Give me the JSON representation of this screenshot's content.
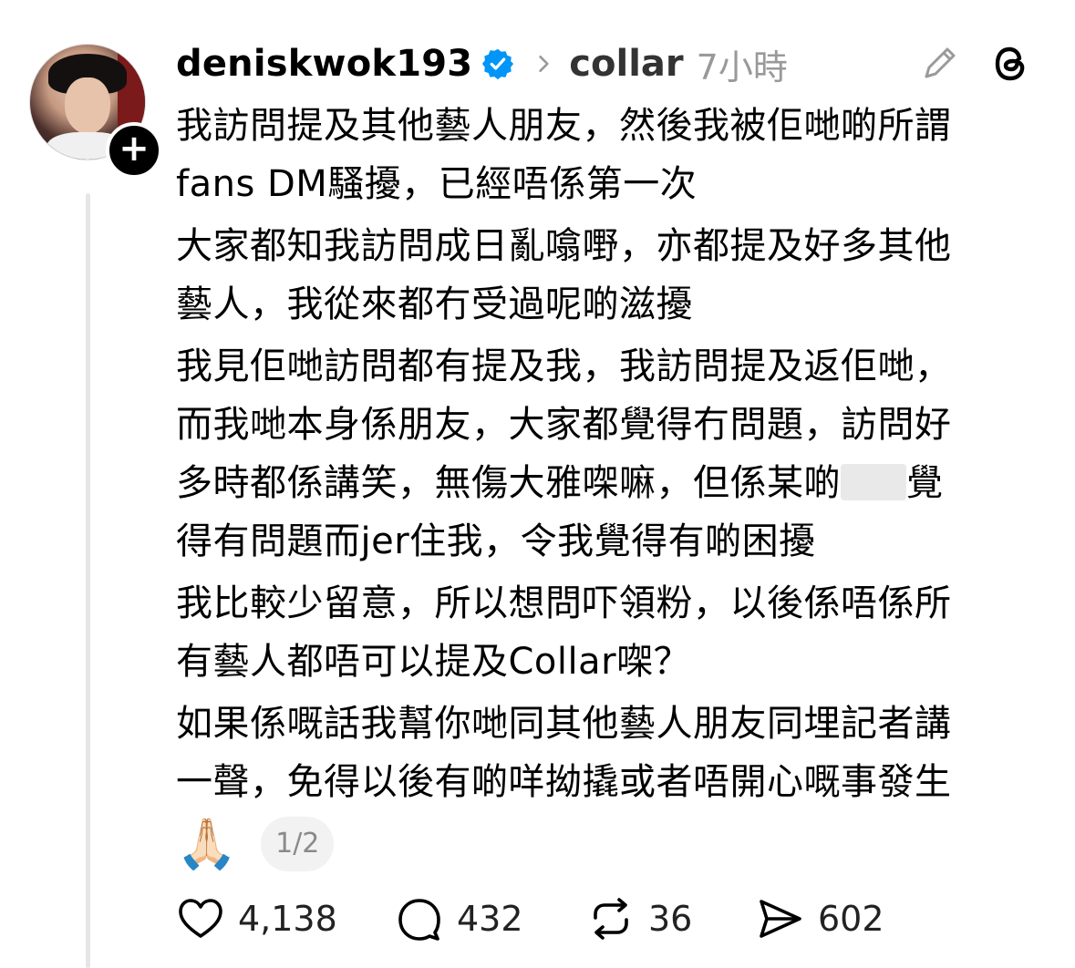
{
  "post": {
    "username": "deniskwok193",
    "topic": "collar",
    "time_ago": "7小時",
    "follow_symbol": "+",
    "paragraphs": [
      {
        "lines": [
          "我訪問提及其他藝人朋友，然後我被佢哋啲所謂",
          "fans DM騷擾，已經唔係第一次"
        ]
      },
      {
        "lines": [
          "大家都知我訪問成日亂噏嘢，亦都提及好多其他",
          "藝人，我從來都冇受過呢啲滋擾"
        ]
      },
      {
        "lines": [
          "我見佢哋訪問都有提及我，我訪問提及返佢哋，",
          "而我哋本身係朋友，大家都覺得冇問題，訪問好"
        ],
        "line3_before_blur": "多時都係講笑，無傷大雅㗎嘛，但係某啲",
        "line3_after_blur": "覺",
        "line4": "得有問題而jer住我，令我覺得有啲困擾"
      },
      {
        "lines": [
          "我比較少留意，所以想問吓領粉，以後係唔係所",
          "有藝人都唔可以提及Collar㗎？"
        ]
      },
      {
        "lines": [
          "如果係嘅話我幫你哋同其他藝人朋友同埋記者講",
          "一聲，免得以後有啲咩拗撬或者唔開心嘅事發生"
        ]
      }
    ],
    "emoji": "🙏🏻",
    "page_indicator": "1/2",
    "stats": {
      "likes": "4,138",
      "comments": "432",
      "reposts": "36",
      "shares": "602"
    }
  },
  "colors": {
    "verified_blue": "#0095f6",
    "muted_text": "#999999",
    "thread_line": "#e6e6e6"
  },
  "icons": [
    "verified-badge-icon",
    "chevron-right-icon",
    "edit-icon",
    "threads-logo-icon",
    "heart-icon",
    "comment-icon",
    "repost-icon",
    "share-icon"
  ]
}
